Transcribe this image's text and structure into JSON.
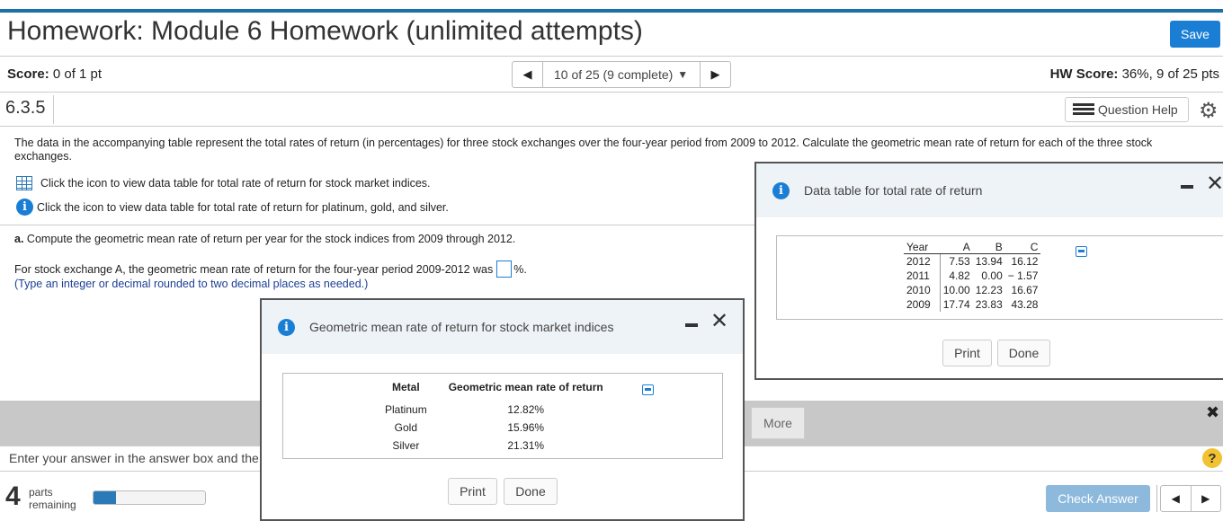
{
  "header": {
    "title": "Homework: Module 6 Homework (unlimited attempts)",
    "save_label": "Save"
  },
  "status": {
    "score_label": "Score:",
    "score_value": "0 of 1 pt",
    "nav_text": "10 of 25 (9 complete)",
    "hw_label": "HW Score:",
    "hw_value": "36%, 9 of 25 pts"
  },
  "question": {
    "number": "6.3.5",
    "help_label": "Question Help",
    "text": "The data in the accompanying table represent the total rates of return (in percentages) for three stock exchanges over the four-year period from 2009 to 2012. Calculate the geometric mean rate of return for each of the three stock exchanges.",
    "link1": "Click the icon to view data table for total rate of return for stock market indices.",
    "link2": "Click the icon to view data table for total rate of return for platinum, gold, and silver.",
    "part_a_label": "a.",
    "part_a_text": "Compute the geometric mean rate of return per year for the stock indices from 2009 through 2012.",
    "answer_prompt": "For stock exchange A, the geometric mean rate of return for the four-year period 2009-2012 was",
    "answer_suffix": "%.",
    "hint": "(Type an integer or decimal rounded to two decimal places as needed.)"
  },
  "footer": {
    "more_label": "More",
    "enter_text": "Enter your answer in the answer box and the",
    "parts_count": "4",
    "parts_label_1": "parts",
    "parts_label_2": "remaining",
    "progress_fraction": 0.2,
    "check_label": "Check Answer"
  },
  "dialog_data": {
    "title": "Data table for total rate of return",
    "headers": [
      "Year",
      "A",
      "B",
      "C"
    ],
    "rows": [
      [
        "2012",
        "7.53",
        "13.94",
        "16.12"
      ],
      [
        "2011",
        "4.82",
        "0.00",
        "− 1.57"
      ],
      [
        "2010",
        "10.00",
        "12.23",
        "16.67"
      ],
      [
        "2009",
        "17.74",
        "23.83",
        "43.28"
      ]
    ],
    "print_label": "Print",
    "done_label": "Done"
  },
  "dialog_gm": {
    "title": "Geometric mean rate of return for stock market indices",
    "headers": [
      "Metal",
      "Geometric mean rate of return"
    ],
    "rows": [
      [
        "Platinum",
        "12.82%"
      ],
      [
        "Gold",
        "15.96%"
      ],
      [
        "Silver",
        "21.31%"
      ]
    ],
    "print_label": "Print",
    "done_label": "Done"
  },
  "colors": {
    "accent": "#1a7fd4",
    "topbar": "#1c6fa8",
    "check_disabled": "#8db9dd"
  }
}
